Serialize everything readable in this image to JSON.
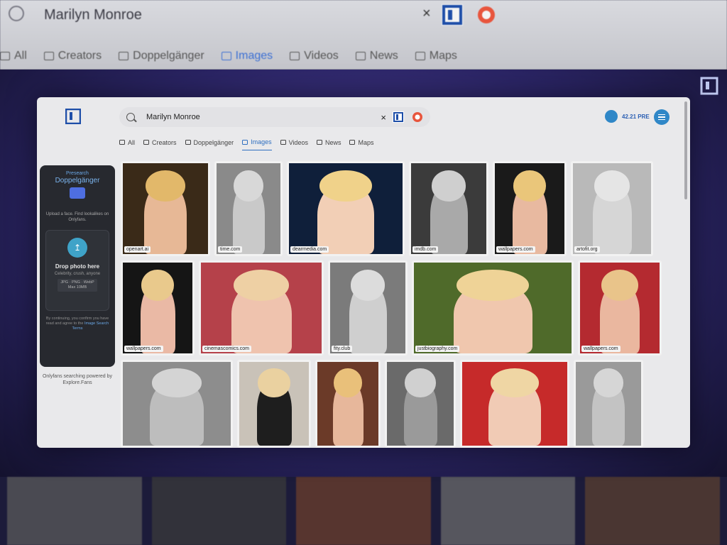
{
  "background_bar": {
    "query": "Marilyn Monroe",
    "close": "×",
    "tabs": [
      {
        "label": "All"
      },
      {
        "label": "Creators"
      },
      {
        "label": "Doppelgänger"
      },
      {
        "label": "Images",
        "active": true
      },
      {
        "label": "Videos"
      },
      {
        "label": "News"
      },
      {
        "label": "Maps"
      }
    ]
  },
  "search": {
    "query": "Marilyn Monroe",
    "close": "×"
  },
  "header": {
    "credits": "42.21 PRE"
  },
  "tabs": [
    {
      "label": "All"
    },
    {
      "label": "Creators"
    },
    {
      "label": "Doppelgänger"
    },
    {
      "label": "Images",
      "active": true
    },
    {
      "label": "Videos"
    },
    {
      "label": "News"
    },
    {
      "label": "Maps"
    }
  ],
  "sidebar": {
    "brand": "Presearch",
    "title": "Doppelgänger",
    "desc": "Upload a face. Find lookalikes on Onlyfans.",
    "drop_title": "Drop photo here",
    "drop_sub": "Celebrity, crush, anyone",
    "formats": "JPG · PNG · WebP",
    "max": "Max 10MB",
    "terms": "By continuing, you confirm you have read and agree to the",
    "terms_link": "Image Search Terms",
    "powered": "Onlyfans searching powered by Explore.Fans"
  },
  "images": [
    [
      {
        "source": "openart.ai",
        "bg": "#3a2a18",
        "hair": "#e2b86a",
        "skin": "#e7b896"
      },
      {
        "source": "time.com",
        "bg": "#8a8a8a",
        "hair": "#d8d8d8",
        "skin": "#c9c9c9"
      },
      {
        "source": "dearmedia.com",
        "bg": "#0f1f3a",
        "hair": "#f0d28a",
        "skin": "#f2cfb6"
      },
      {
        "source": "imdb.com",
        "bg": "#3b3b3b",
        "hair": "#cfcfcf",
        "skin": "#a9a9a9"
      },
      {
        "source": "wallpapers.com",
        "bg": "#1a1a1a",
        "hair": "#eac67a",
        "skin": "#e8b9a0"
      },
      {
        "source": "artofit.org",
        "bg": "#b9b9b9",
        "hair": "#e5e5e5",
        "skin": "#d6d6d6"
      }
    ],
    [
      {
        "source": "wallpapers.com",
        "bg": "#151515",
        "hair": "#e9c98c",
        "skin": "#eab9a5"
      },
      {
        "source": "cinemascomics.com",
        "bg": "#b5414a",
        "hair": "#eed0a4",
        "skin": "#efc3ae"
      },
      {
        "source": "fity.club",
        "bg": "#7b7b7b",
        "hair": "#dcdcdc",
        "skin": "#cfcfcf"
      },
      {
        "source": "justbiography.com",
        "bg": "#4f6a2a",
        "hair": "#efd397",
        "skin": "#f0c7ae"
      },
      {
        "source": "wallpapers.com",
        "bg": "#b42a30",
        "hair": "#e9c48a",
        "skin": "#eab79f"
      }
    ],
    [
      {
        "source": "",
        "bg": "#8d8d8d",
        "hair": "#d4d4d4",
        "skin": "#bdbdbd"
      },
      {
        "source": "",
        "bg": "#c9c2b8",
        "hair": "#ead1a0",
        "skin": "#1e1e1e"
      },
      {
        "source": "",
        "bg": "#6b3a28",
        "hair": "#e9c07a",
        "skin": "#e7b79b"
      },
      {
        "source": "",
        "bg": "#6a6a6a",
        "hair": "#d0d0d0",
        "skin": "#9a9a9a"
      },
      {
        "source": "",
        "bg": "#c62a2a",
        "hair": "#efd6a4",
        "skin": "#f1cbb5"
      },
      {
        "source": "",
        "bg": "#9a9a9a",
        "hair": "#d6d6d6",
        "skin": "#c3c3c3"
      }
    ]
  ],
  "colors": {
    "accent": "#2f6fc0",
    "brand_blue": "#1e4ea8",
    "sidebar_bg": "#27292f"
  }
}
